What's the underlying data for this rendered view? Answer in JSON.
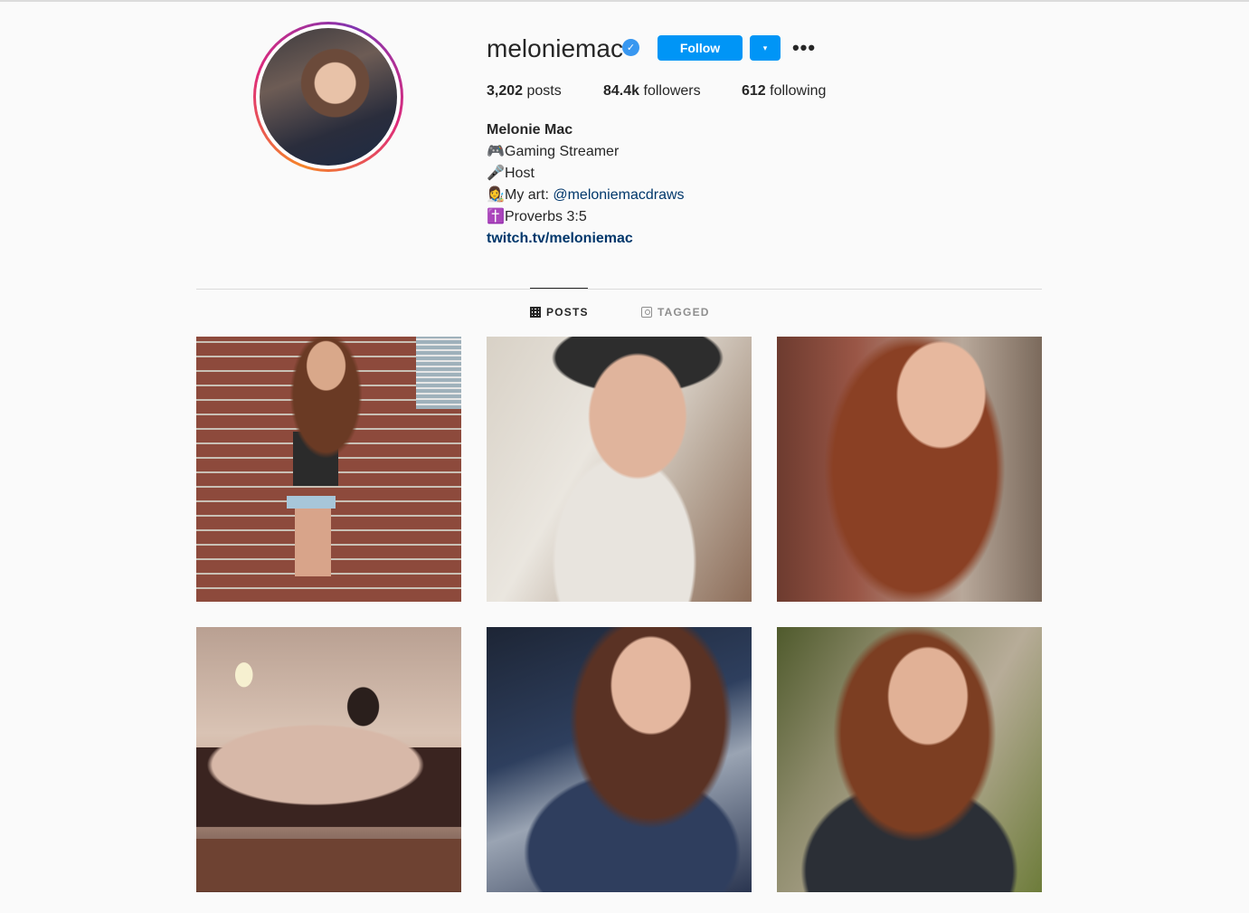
{
  "profile": {
    "username": "meloniemac",
    "verified_icon": "verified-badge-icon",
    "follow_label": "Follow",
    "dropdown_icon": "▾",
    "more_icon": "•••",
    "stats": {
      "posts_count": "3,202",
      "posts_label": "posts",
      "followers_count": "84.4k",
      "followers_label": "followers",
      "following_count": "612",
      "following_label": "following"
    },
    "bio": {
      "name": "Melonie Mac",
      "line1_emoji": "🎮",
      "line1_text": "Gaming Streamer",
      "line2_emoji": "🎤",
      "line2_text": "Host",
      "line3_emoji": "👩‍🎨",
      "line3_text": "My art: ",
      "line3_mention": "@meloniemacdraws",
      "line4_emoji": "✝️",
      "line4_text": "Proverbs 3:5",
      "link": "twitch.tv/meloniemac"
    }
  },
  "tabs": [
    {
      "label": "POSTS",
      "active": true
    },
    {
      "label": "TAGGED",
      "active": false
    }
  ],
  "colors": {
    "accent": "#0095f6",
    "link": "#00376b",
    "background": "#fafafa"
  }
}
